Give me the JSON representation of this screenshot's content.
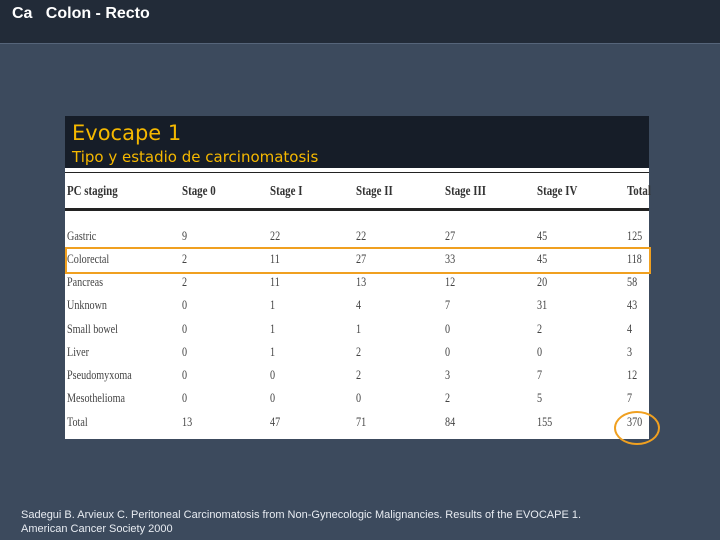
{
  "header": {
    "title": "Ca   Colon - Recto"
  },
  "panel": {
    "title": "Evocape 1",
    "subtitle": "Tipo y estadio de carcinomatosis"
  },
  "table": {
    "columns": [
      "PC staging",
      "Stage 0",
      "Stage I",
      "Stage II",
      "Stage III",
      "Stage IV",
      "Total"
    ],
    "rows": [
      [
        "Gastric",
        "9",
        "22",
        "22",
        "27",
        "45",
        "125"
      ],
      [
        "Colorectal",
        "2",
        "11",
        "27",
        "33",
        "45",
        "118"
      ],
      [
        "Pancreas",
        "2",
        "11",
        "13",
        "12",
        "20",
        "58"
      ],
      [
        "Unknown",
        "0",
        "1",
        "4",
        "7",
        "31",
        "43"
      ],
      [
        "Small bowel",
        "0",
        "1",
        "1",
        "0",
        "2",
        "4"
      ],
      [
        "Liver",
        "0",
        "1",
        "2",
        "0",
        "0",
        "3"
      ],
      [
        "Pseudomyxoma",
        "0",
        "0",
        "2",
        "3",
        "7",
        "12"
      ],
      [
        "Mesothelioma",
        "0",
        "0",
        "0",
        "2",
        "5",
        "7"
      ],
      [
        "Total",
        "13",
        "47",
        "71",
        "84",
        "155",
        "370"
      ]
    ],
    "highlighted_row": "Colorectal",
    "highlighted_cell": "370",
    "highlight_color": "#f0a020"
  },
  "footnote": {
    "line1": "Sadegui B. Arvieux C. Peritoneal Carcinomatosis from Non-Gynecologic Malignancies. Results of the EVOCAPE 1.",
    "line2": "American Cancer Society 2000"
  }
}
